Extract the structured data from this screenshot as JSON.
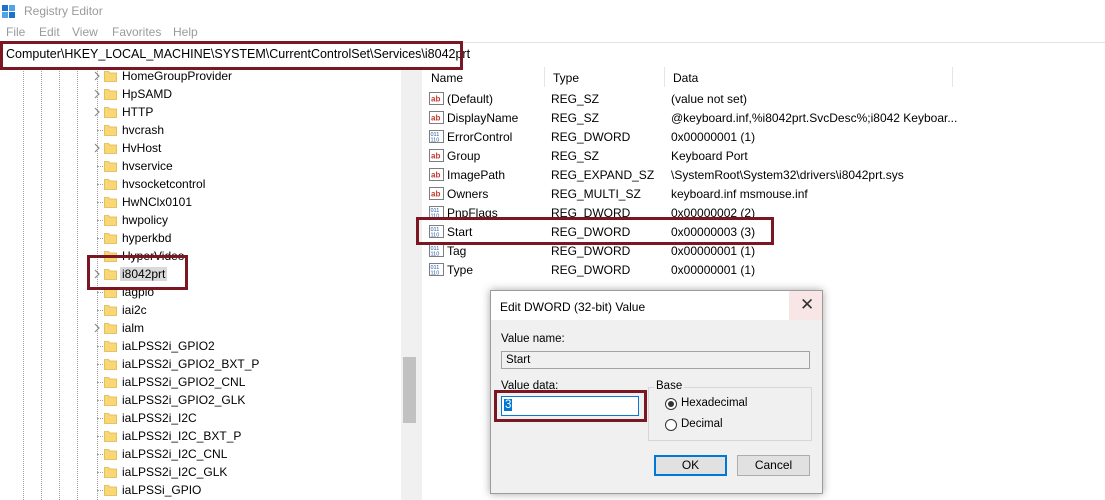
{
  "window": {
    "title": "Registry Editor"
  },
  "menu": [
    "File",
    "Edit",
    "View",
    "Favorites",
    "Help"
  ],
  "address": {
    "path": "Computer\\HKEY_LOCAL_MACHINE\\SYSTEM\\CurrentControlSet\\Services\\i8042prt"
  },
  "tree": {
    "items": [
      {
        "label": "HomeGroupProvider",
        "expandable": true,
        "selected": false
      },
      {
        "label": "HpSAMD",
        "expandable": true,
        "selected": false
      },
      {
        "label": "HTTP",
        "expandable": true,
        "selected": false
      },
      {
        "label": "hvcrash",
        "expandable": false,
        "selected": false
      },
      {
        "label": "HvHost",
        "expandable": true,
        "selected": false
      },
      {
        "label": "hvservice",
        "expandable": false,
        "selected": false
      },
      {
        "label": "hvsocketcontrol",
        "expandable": false,
        "selected": false
      },
      {
        "label": "HwNClx0101",
        "expandable": false,
        "selected": false
      },
      {
        "label": "hwpolicy",
        "expandable": false,
        "selected": false
      },
      {
        "label": "hyperkbd",
        "expandable": false,
        "selected": false
      },
      {
        "label": "HyperVideo",
        "expandable": false,
        "selected": false
      },
      {
        "label": "i8042prt",
        "expandable": true,
        "selected": true
      },
      {
        "label": "iagpio",
        "expandable": false,
        "selected": false
      },
      {
        "label": "iai2c",
        "expandable": false,
        "selected": false
      },
      {
        "label": "ialm",
        "expandable": true,
        "selected": false
      },
      {
        "label": "iaLPSS2i_GPIO2",
        "expandable": false,
        "selected": false
      },
      {
        "label": "iaLPSS2i_GPIO2_BXT_P",
        "expandable": false,
        "selected": false
      },
      {
        "label": "iaLPSS2i_GPIO2_CNL",
        "expandable": false,
        "selected": false
      },
      {
        "label": "iaLPSS2i_GPIO2_GLK",
        "expandable": false,
        "selected": false
      },
      {
        "label": "iaLPSS2i_I2C",
        "expandable": false,
        "selected": false
      },
      {
        "label": "iaLPSS2i_I2C_BXT_P",
        "expandable": false,
        "selected": false
      },
      {
        "label": "iaLPSS2i_I2C_CNL",
        "expandable": false,
        "selected": false
      },
      {
        "label": "iaLPSS2i_I2C_GLK",
        "expandable": false,
        "selected": false
      },
      {
        "label": "iaLPSSi_GPIO",
        "expandable": false,
        "selected": false
      }
    ]
  },
  "values": {
    "columns": [
      "Name",
      "Type",
      "Data"
    ],
    "rows": [
      {
        "icon": "string-value-icon",
        "name": "(Default)",
        "type": "REG_SZ",
        "data": "(value not set)"
      },
      {
        "icon": "string-value-icon",
        "name": "DisplayName",
        "type": "REG_SZ",
        "data": "@keyboard.inf,%i8042prt.SvcDesc%;i8042 Keyboar..."
      },
      {
        "icon": "binary-value-icon",
        "name": "ErrorControl",
        "type": "REG_DWORD",
        "data": "0x00000001 (1)"
      },
      {
        "icon": "string-value-icon",
        "name": "Group",
        "type": "REG_SZ",
        "data": "Keyboard Port"
      },
      {
        "icon": "string-value-icon",
        "name": "ImagePath",
        "type": "REG_EXPAND_SZ",
        "data": "\\SystemRoot\\System32\\drivers\\i8042prt.sys"
      },
      {
        "icon": "string-value-icon",
        "name": "Owners",
        "type": "REG_MULTI_SZ",
        "data": "keyboard.inf msmouse.inf"
      },
      {
        "icon": "binary-value-icon",
        "name": "PnpFlags",
        "type": "REG_DWORD",
        "data": "0x00000002 (2)"
      },
      {
        "icon": "binary-value-icon",
        "name": "Start",
        "type": "REG_DWORD",
        "data": "0x00000003 (3)"
      },
      {
        "icon": "binary-value-icon",
        "name": "Tag",
        "type": "REG_DWORD",
        "data": "0x00000001 (1)"
      },
      {
        "icon": "binary-value-icon",
        "name": "Type",
        "type": "REG_DWORD",
        "data": "0x00000001 (1)"
      }
    ]
  },
  "dialog": {
    "title": "Edit DWORD (32-bit) Value",
    "close": "✕",
    "value_name_label": "Value name:",
    "value_name": "Start",
    "value_data_label": "Value data:",
    "value_data": "3",
    "base_label": "Base",
    "hex_label": "Hexadecimal",
    "dec_label": "Decimal",
    "base_selected": "Hexadecimal",
    "ok": "OK",
    "cancel": "Cancel"
  },
  "colors": {
    "highlight_border": "#7b1623",
    "selection": "#0078d7",
    "folder": "#f8d774"
  }
}
